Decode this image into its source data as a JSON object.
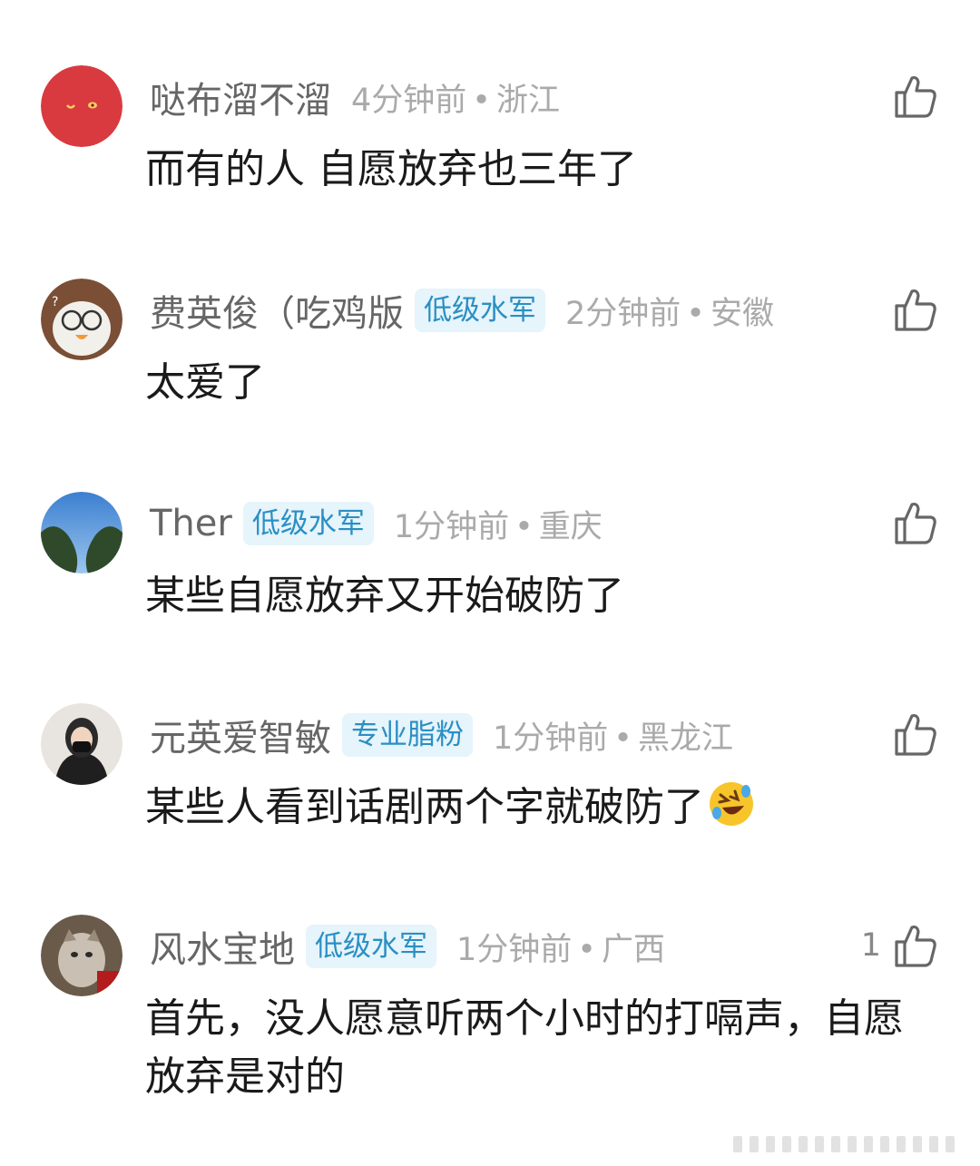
{
  "comments": [
    {
      "username": "哒布溜不溜",
      "badge": "",
      "time": "4分钟前",
      "location": "浙江",
      "likes": "",
      "text": "而有的人 自愿放弃也三年了"
    },
    {
      "username": "费英俊（吃鸡版",
      "badge": "低级水军",
      "time": "2分钟前",
      "location": "安徽",
      "likes": "",
      "text": "太爱了"
    },
    {
      "username": "Ther",
      "badge": "低级水军",
      "time": "1分钟前",
      "location": "重庆",
      "likes": "",
      "text": "某些自愿放弃又开始破防了"
    },
    {
      "username": "元英爱智敏",
      "badge": "专业脂粉",
      "time": "1分钟前",
      "location": "黑龙江",
      "likes": "",
      "text": "某些人看到话剧两个字就破防了",
      "emoji": "rolling-on-floor-laughing-emoji"
    },
    {
      "username": "风水宝地",
      "badge": "低级水军",
      "time": "1分钟前",
      "location": "广西",
      "likes": "1",
      "text": "首先，没人愿意听两个小时的打嗝声，自愿放弃是对的"
    }
  ],
  "separator": "•",
  "icons": {
    "like": "thumbs-up-icon",
    "scroll": "scroll-indicator"
  },
  "colors": {
    "badge_text": "#2a8fc4",
    "badge_bg": "#e6f4fb",
    "username": "#666666",
    "meta": "#aaaaaa"
  }
}
